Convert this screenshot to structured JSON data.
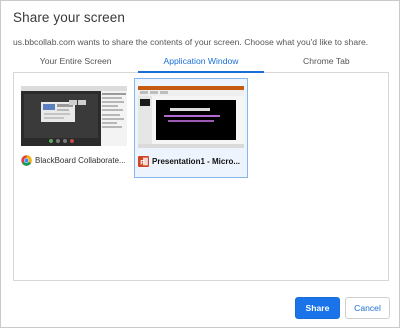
{
  "dialog": {
    "title": "Share your screen",
    "subtitle": "us.bbcollab.com wants to share the contents of your screen. Choose what you'd like to share."
  },
  "tabs": [
    {
      "label": "Your Entire Screen",
      "active": false
    },
    {
      "label": "Application Window",
      "active": true
    },
    {
      "label": "Chrome Tab",
      "active": false
    }
  ],
  "windows": [
    {
      "label": "BlackBoard Collaborate...",
      "icon": "chrome-icon",
      "selected": false
    },
    {
      "label": "Presentation1 - Micro...",
      "icon": "powerpoint-icon",
      "selected": true
    }
  ],
  "buttons": {
    "share": "Share",
    "cancel": "Cancel"
  },
  "colors": {
    "accent": "#1a73e8",
    "selected_tile_bg": "#eef4fd",
    "selected_tile_border": "#86b4ec"
  }
}
